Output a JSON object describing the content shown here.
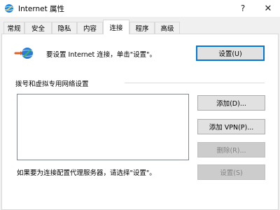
{
  "window": {
    "title": "Internet 属性",
    "help_glyph": "?",
    "close_glyph": "✕"
  },
  "tabs": [
    {
      "label": "常规"
    },
    {
      "label": "安全"
    },
    {
      "label": "隐私"
    },
    {
      "label": "内容"
    },
    {
      "label": "连接",
      "active": true
    },
    {
      "label": "程序"
    },
    {
      "label": "高级"
    }
  ],
  "setup": {
    "text": "要设置 Internet 连接，单击\"设置\"。",
    "button_label": "设置(U)"
  },
  "dialup": {
    "section_label": "拨号和虚拟专用网络设置",
    "add_label": "添加(D)...",
    "add_vpn_label": "添加 VPN(P)...",
    "remove_label": "删除(R)...",
    "settings_label": "设置(S)"
  },
  "proxy": {
    "text": "如果要为连接配置代理服务器，请选择\"设置\"。"
  },
  "colors": {
    "accent": "#0078d7",
    "window_bg": "#f0f0f0",
    "panel_bg": "#ffffff",
    "disabled_text": "#838383"
  },
  "icons": {
    "app": "internet-options-globe-icon",
    "network": "network-connection-icon"
  }
}
